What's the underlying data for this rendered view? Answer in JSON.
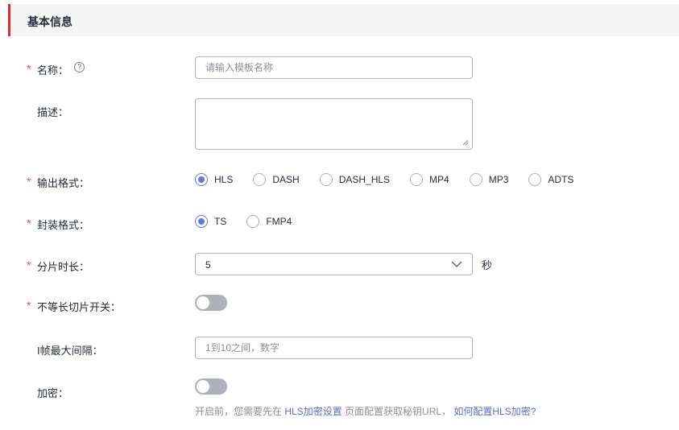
{
  "section": {
    "title": "基本信息"
  },
  "form": {
    "name": {
      "label": "名称：",
      "placeholder": "请输入模板名称",
      "help_icon": "question-circle-icon"
    },
    "description": {
      "label": "描述："
    },
    "output_format": {
      "label": "输出格式：",
      "options": [
        "HLS",
        "DASH",
        "DASH_HLS",
        "MP4",
        "MP3",
        "ADTS"
      ],
      "selected": "HLS"
    },
    "container_format": {
      "label": "封装格式：",
      "options": [
        "TS",
        "FMP4"
      ],
      "selected": "TS"
    },
    "segment_duration": {
      "label": "分片时长：",
      "value": "5",
      "unit": "秒"
    },
    "variable_segment": {
      "label": "不等长切片开关：",
      "enabled": false
    },
    "iframe_interval": {
      "label": "I帧最大间隔：",
      "placeholder": "1到10之间，数字"
    },
    "encryption": {
      "label": "加密：",
      "enabled": false,
      "hint_prefix": "开启前，您需要先在 ",
      "hint_link1": "HLS加密设置",
      "hint_middle": " 页面配置获取秘钥URL，  ",
      "hint_link2": "如何配置HLS加密?"
    }
  },
  "colors": {
    "accent": "#5e7ce0",
    "required": "#e84d4d",
    "header_bar": "#e02a2a",
    "link": "#526ecc"
  }
}
